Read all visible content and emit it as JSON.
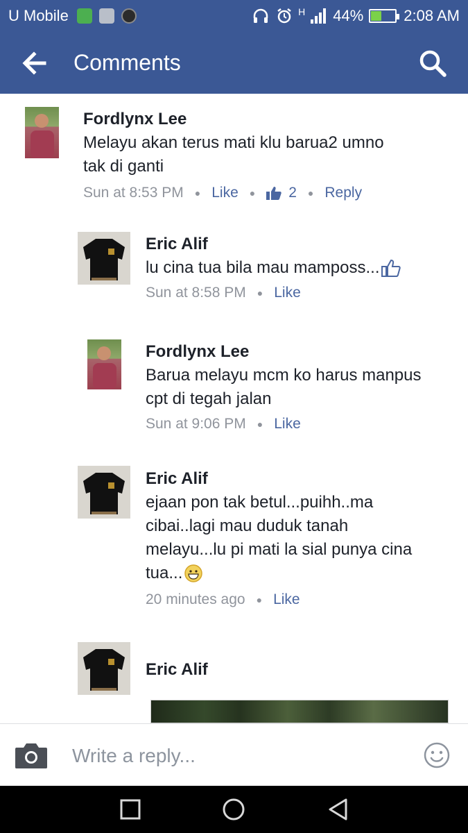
{
  "status_bar": {
    "carrier": "U Mobile",
    "network_type": "H",
    "battery": "44%",
    "battery_level": 0.44,
    "time": "2:08 AM",
    "icons": [
      "headphones-app-icon",
      "image-icon",
      "app-icon",
      "headphones-icon",
      "alarm-icon",
      "signal-icon",
      "battery-icon"
    ]
  },
  "app_bar": {
    "title": "Comments",
    "back_icon": "arrow-left-icon",
    "search_icon": "search-icon",
    "color": "#3b5895"
  },
  "comments": [
    {
      "author": "Fordlynx Lee",
      "lines": [
        "Melayu akan terus mati klu  barua2 umno",
        "tak di ganti"
      ],
      "time": "Sun at 8:53 PM",
      "like_label": "Like",
      "like_count": "2",
      "reply_label": "Reply"
    },
    {
      "author": "Eric Alif",
      "lines": [
        "lu cina tua bila mau mamposs..."
      ],
      "trailing_icon": "thumbs-up-icon",
      "time": "Sun at 8:58 PM",
      "like_label": "Like"
    },
    {
      "author": "Fordlynx Lee",
      "lines": [
        "Barua melayu mcm ko harus manpus",
        "cpt di tegah jalan"
      ],
      "time": "Sun at 9:06 PM",
      "like_label": "Like"
    },
    {
      "author": "Eric Alif",
      "lines": [
        "ejaan pon tak betul...puihh..ma",
        "cibai..lagi mau duduk tanah",
        "melayu...lu pi mati la sial punya cina",
        "tua..."
      ],
      "trailing_icon": "grinning-emoji-icon",
      "time": "20 minutes ago",
      "like_label": "Like"
    },
    {
      "author": "Eric Alif"
    }
  ],
  "reply_bar": {
    "placeholder": "Write a reply...",
    "camera_icon": "camera-icon",
    "emoji_icon": "smiley-icon"
  },
  "nav_bar": {
    "icons": [
      "recent-apps-icon",
      "home-icon",
      "back-icon"
    ]
  },
  "colors": {
    "brand": "#3b5895",
    "link": "#4b67a1",
    "meta": "#90949c",
    "text": "#1d2129"
  }
}
